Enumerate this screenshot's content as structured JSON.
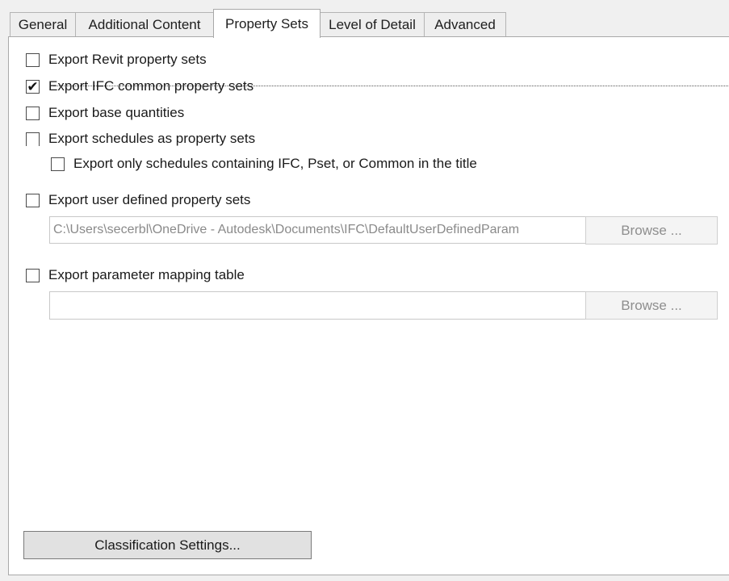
{
  "tabs": [
    "General",
    "Additional Content",
    "Property Sets",
    "Level of Detail",
    "Advanced"
  ],
  "active_tab": "Property Sets",
  "options": {
    "export_revit_property_sets": {
      "label": "Export Revit property sets",
      "checked": false
    },
    "export_ifc_common_property_sets": {
      "label": "Export IFC common property sets",
      "checked": true
    },
    "export_base_quantities": {
      "label": "Export base quantities",
      "checked": false
    },
    "export_schedules_as_property_sets": {
      "label": "Export schedules as property sets",
      "checked": false
    },
    "export_only_schedules_ifc": {
      "label": "Export only schedules containing IFC, Pset, or Common in the title",
      "checked": false
    },
    "export_user_defined_property_sets": {
      "label": "Export user defined property sets",
      "checked": false
    },
    "export_parameter_mapping_table": {
      "label": "Export parameter mapping table",
      "checked": false
    }
  },
  "user_defined_path": {
    "value": "C:\\Users\\secerbl\\OneDrive - Autodesk\\Documents\\IFC\\DefaultUserDefinedParam",
    "browse_label": "Browse ..."
  },
  "mapping_table_path": {
    "value": "",
    "browse_label": "Browse ..."
  },
  "classification_button_label": "Classification Settings...",
  "checkmark_glyph": "✔"
}
